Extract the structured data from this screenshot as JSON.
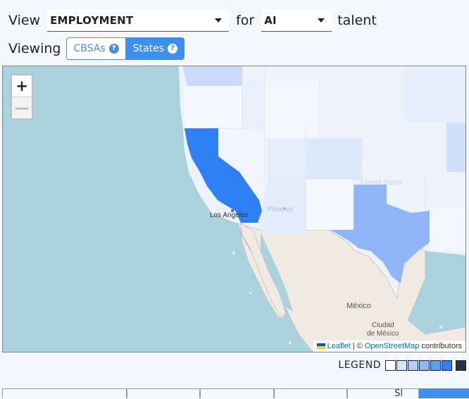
{
  "controls": {
    "view_label": "View",
    "metric_value": "EMPLOYMENT",
    "for_label": "for",
    "talent_value": "AI",
    "talent_label": "talent",
    "viewing_label": "Viewing",
    "geo_options": [
      "CBSAs",
      "States"
    ],
    "geo_selected": "States",
    "help_icon": "question-circle-icon"
  },
  "map": {
    "zoom_in": "+",
    "zoom_out": "—",
    "place_labels": {
      "los_angeles": "Los Angeles",
      "phoenix": "Phoenix",
      "united_states": "United States",
      "mexico": "México",
      "mexico_city_line1": "Ciudad",
      "mexico_city_line2": "de México"
    },
    "attribution": {
      "leaflet": "Leaflet",
      "separator": " | © ",
      "osm": "OpenStreetMap",
      "suffix": " contributors"
    },
    "colors": {
      "ocean": "#aad3df",
      "mexico_land": "#f0ebe2",
      "california": "#2f80f5",
      "texas": "#8fb6f8",
      "oregon": "#f0f4fc",
      "washington": "#c8dcf8"
    }
  },
  "legend": {
    "label": "LEGEND",
    "swatches": [
      "#ffffff",
      "#d6e6fc",
      "#b3d0fa",
      "#8ab8f8",
      "#5c9ef6",
      "#2f80f5",
      "#2a3142"
    ]
  },
  "tabs": {
    "partial_text": "Sl",
    "count": 6,
    "active_index": 5
  }
}
